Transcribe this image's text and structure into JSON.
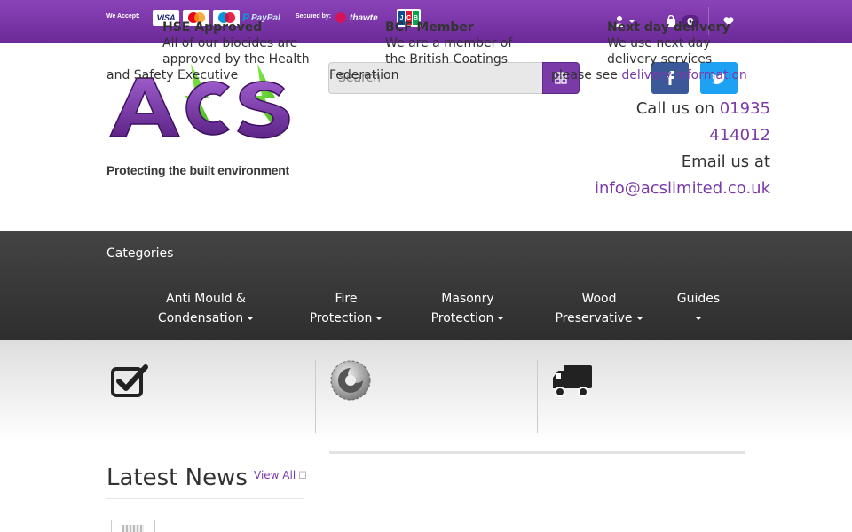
{
  "topbar": {
    "accept_label": "We Accept:",
    "secured_label": "Secured by:",
    "cards": {
      "visa": "VISA",
      "paypal": "PayPal",
      "thawte": "thawte",
      "jcb": [
        "J",
        "C",
        "B"
      ]
    },
    "cart_count": "0",
    "icons": [
      "user-icon",
      "cart-icon",
      "heart-icon"
    ]
  },
  "header": {
    "logo_text": "ACS",
    "tagline": "Protecting the built environment",
    "search_placeholder": "Search",
    "call_prefix": "Call us on",
    "phone_1": "01935",
    "phone_2": "414012",
    "email_prefix": "Email us at",
    "email": "info@acslimited.co.uk",
    "social": [
      "facebook-icon",
      "twitter-icon"
    ]
  },
  "nav": {
    "title": "Categories",
    "items": [
      {
        "line1": "Anti Mould &",
        "line2": "Condensation"
      },
      {
        "line1": "Fire",
        "line2": "Protection"
      },
      {
        "line1": "Masonry",
        "line2": "Protection"
      },
      {
        "line1": "Wood",
        "line2": "Preservative"
      },
      {
        "line1": "Guides",
        "line2": ""
      }
    ]
  },
  "features": [
    {
      "title": "HSE Approved",
      "text_1": "All of our biocides are",
      "text_2": "approved by the Health",
      "text_3": "and Safety Executive"
    },
    {
      "title": "BCF Member",
      "text_1": "We are a member of",
      "text_2": "the British Coatings",
      "text_3": "Federatiion"
    },
    {
      "title": "Next day delivery",
      "text_1": "We use next day",
      "text_2": "delivery services",
      "text_3": "please see",
      "link": "delivery information"
    }
  ],
  "news": {
    "title": "Latest News",
    "view_all": "View All"
  },
  "colors": {
    "brand_purple": "#7a3aa8",
    "logo_green": "#5fd12f",
    "nav_dark": "#333333"
  }
}
